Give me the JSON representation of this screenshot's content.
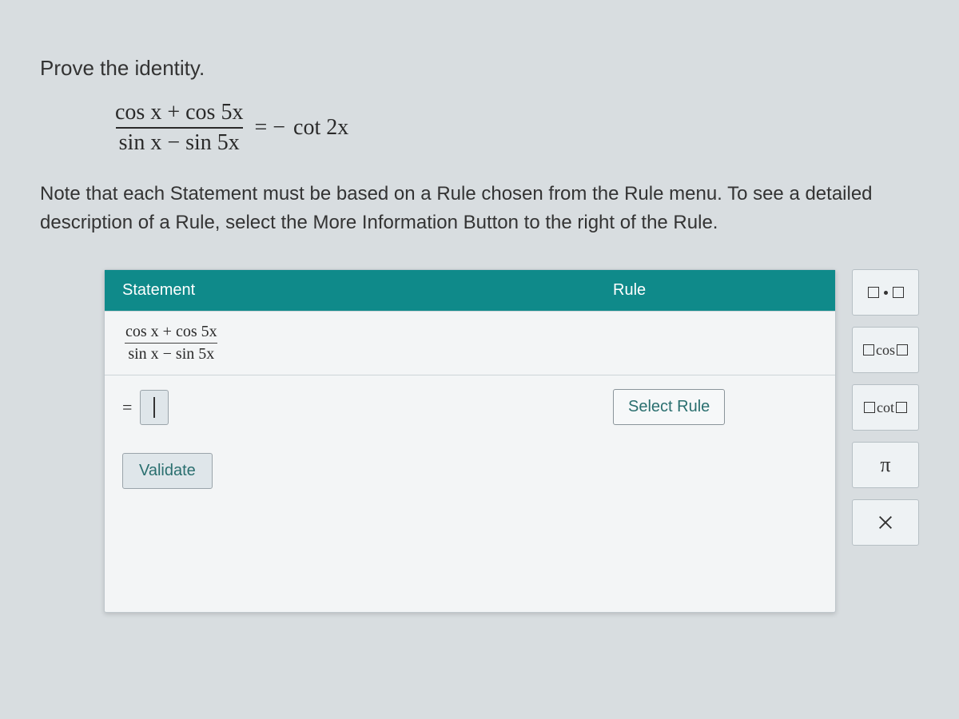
{
  "prompt": {
    "title": "Prove the identity.",
    "identity": {
      "lhs_numerator": "cos x + cos 5x",
      "lhs_denominator": "sin x − sin 5x",
      "equals": "= −",
      "rhs": "cot 2x"
    },
    "note": "Note that each Statement must be based on a Rule chosen from the Rule menu. To see a detailed description of a Rule, select the More Information Button to the right of the Rule."
  },
  "table": {
    "header_statement": "Statement",
    "header_rule": "Rule",
    "row1": {
      "numerator": "cos x + cos 5x",
      "denominator": "sin x − sin 5x"
    },
    "row2": {
      "prefix": "=",
      "select_label": "Select Rule"
    },
    "validate_label": "Validate"
  },
  "toolbox": {
    "cos_label": "cos",
    "cot_label": "cot",
    "pi_label": "π"
  }
}
